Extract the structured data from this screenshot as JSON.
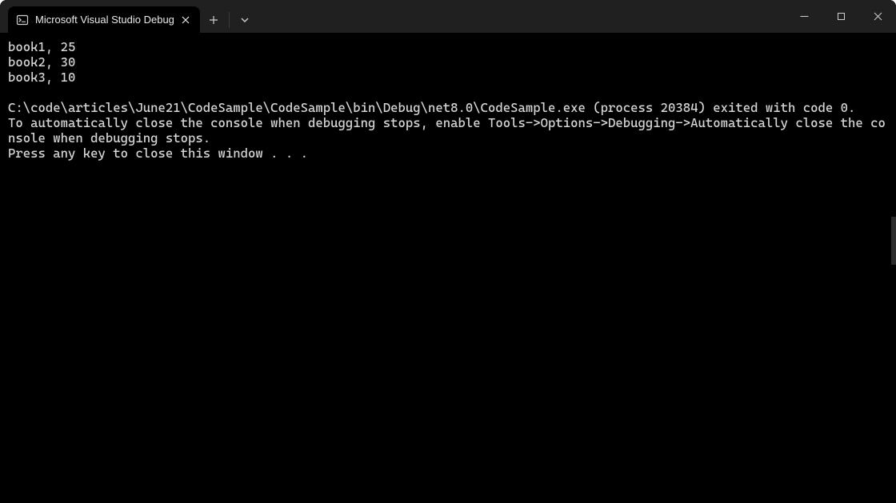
{
  "tab": {
    "title": "Microsoft Visual Studio Debug"
  },
  "console": {
    "lines": [
      "book1, 25",
      "book2, 30",
      "book3, 10",
      "",
      "C:\\code\\articles\\June21\\CodeSample\\CodeSample\\bin\\Debug\\net8.0\\CodeSample.exe (process 20384) exited with code 0.",
      "To automatically close the console when debugging stops, enable Tools->Options->Debugging->Automatically close the console when debugging stops.",
      "Press any key to close this window . . ."
    ]
  }
}
